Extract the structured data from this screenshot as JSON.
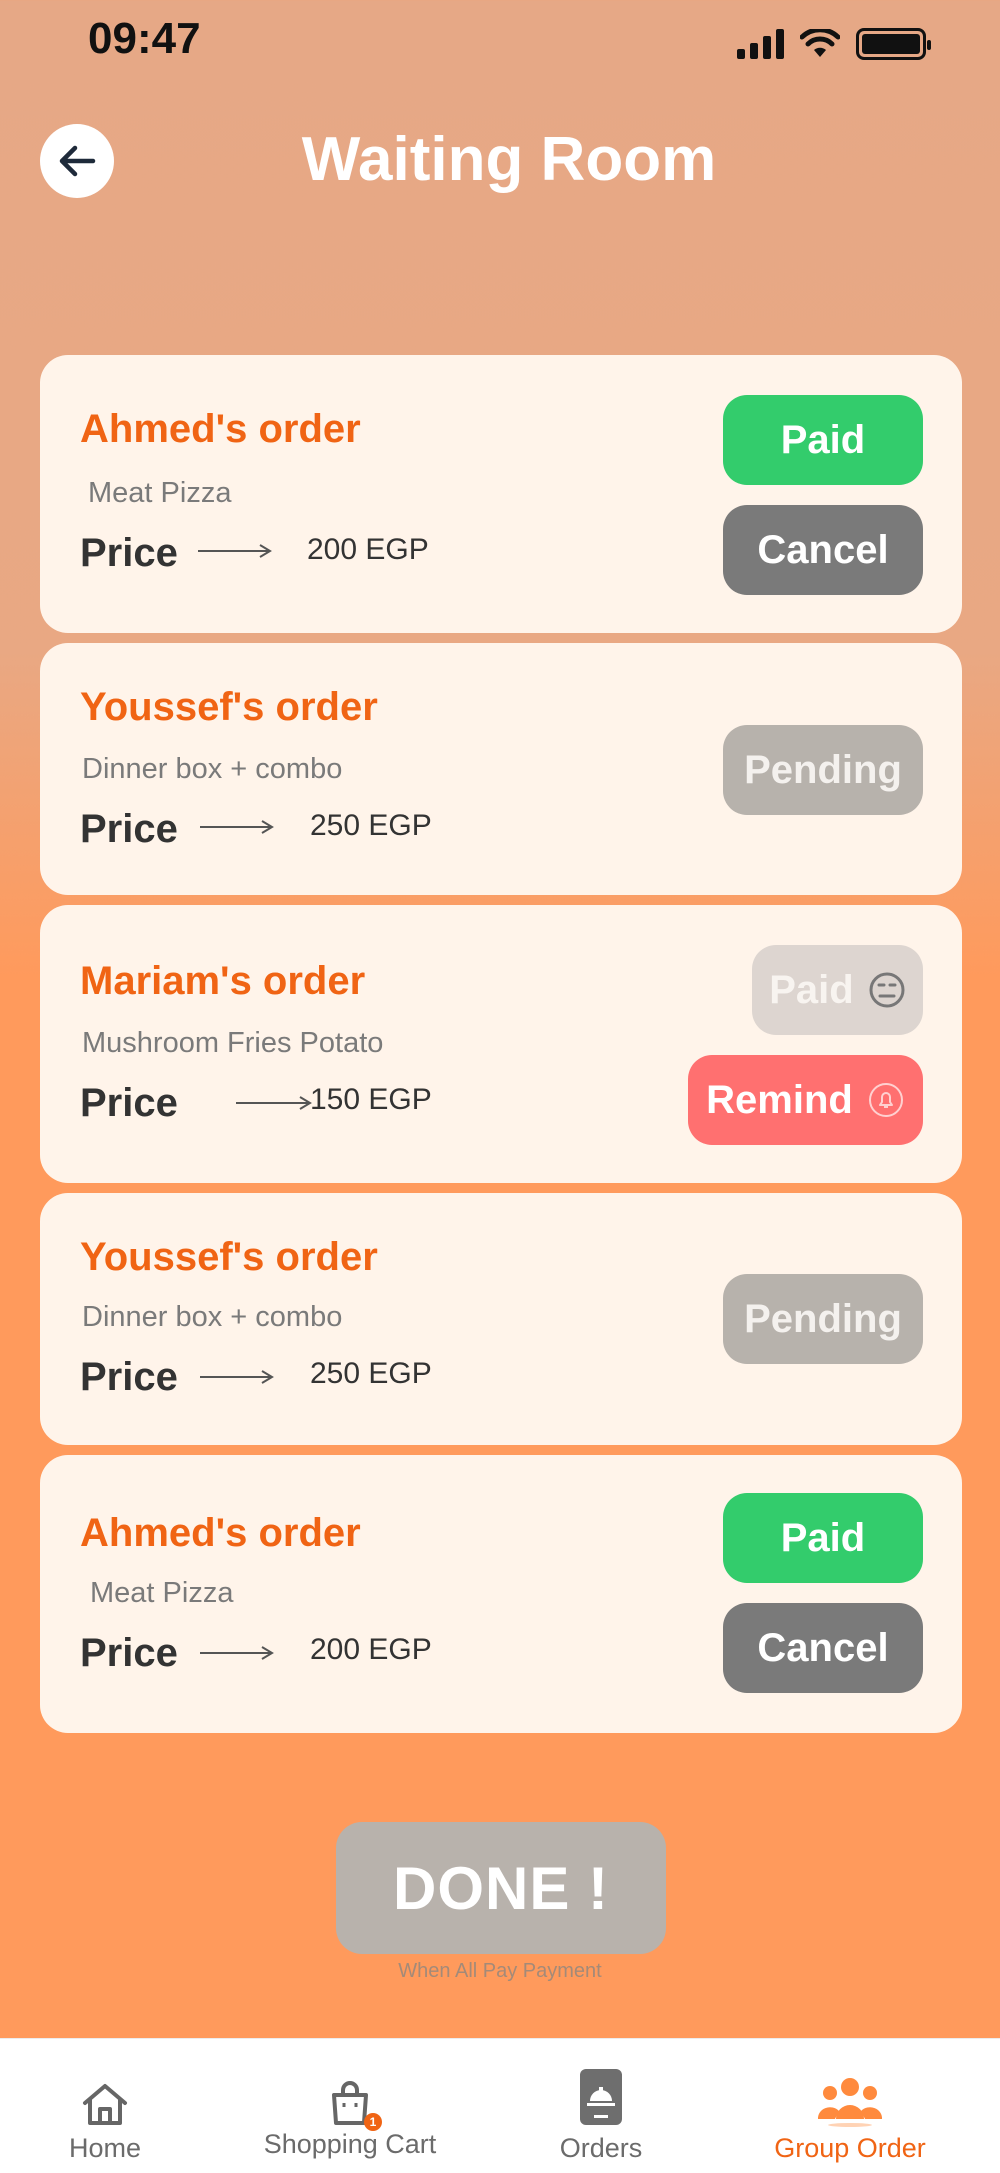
{
  "status_bar": {
    "time": "09:47"
  },
  "header": {
    "title": "Waiting Room"
  },
  "orders": [
    {
      "name": "Ahmed's order",
      "item": "Meat Pizza",
      "price_label": "Price",
      "price": "200 EGP",
      "buttons": [
        "Paid",
        "Cancel"
      ]
    },
    {
      "name": "Youssef's order",
      "item": "Dinner box  + combo",
      "price_label": "Price",
      "price": "250 EGP",
      "buttons": [
        "Pending"
      ]
    },
    {
      "name": "Mariam's order",
      "item": "Mushroom Fries Potato",
      "price_label": "Price",
      "price": "150 EGP",
      "buttons": [
        "Paid",
        "Remind"
      ]
    },
    {
      "name": "Youssef's order",
      "item": "Dinner box  + combo",
      "price_label": "Price",
      "price": "250 EGP",
      "buttons": [
        "Pending"
      ]
    },
    {
      "name": "Ahmed's order",
      "item": "Meat Pizza",
      "price_label": "Price",
      "price": "200 EGP",
      "buttons": [
        "Paid",
        "Cancel"
      ]
    }
  ],
  "done": {
    "label": "DONE !",
    "caption": "When All Pay Payment"
  },
  "tabbar": {
    "items": [
      {
        "label": "Home",
        "icon": "home-icon"
      },
      {
        "label": "Shopping Cart",
        "icon": "shopping-bag-icon",
        "badge": "1"
      },
      {
        "label": "Orders",
        "icon": "orders-icon"
      },
      {
        "label": "Group Order",
        "icon": "group-icon",
        "active": true
      }
    ]
  },
  "colors": {
    "accent": "#f06414",
    "paid": "#33cc6c",
    "cancel": "#7a7a7a",
    "pending": "#b7b2ac",
    "remind": "#ff7070",
    "card": "#fff4ea"
  }
}
